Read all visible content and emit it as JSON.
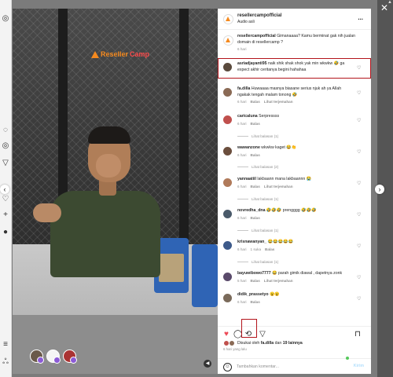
{
  "panel": {
    "username": "resellercampofficial",
    "audio": "Audio asli",
    "more": "..."
  },
  "video": {
    "logo_text_a": "Reseller",
    "logo_text_b": "Camp"
  },
  "comments": [
    {
      "user": "resellercampofficial",
      "text": "Gimanaaaa? Kamu berminat gak nih jualan domain di resellercamp ?",
      "time": "6 hari",
      "reply": "",
      "translate": "",
      "color": "#ffffff"
    },
    {
      "user": "asriadjayanti95",
      "text": "naik shik shak shok yak min wkwkw 🤣 ga expect akhir ceritanya begini hahahaa",
      "time": "",
      "reply": "",
      "translate": "",
      "color": "#5a4a3d"
    },
    {
      "user": "fa.dilla",
      "text": "Huwaaaa masnya biasane serius njuk ah ya Allah ngakak tengah malam tonong 🤣",
      "time": "6 hari",
      "reply": "Balas",
      "translate": "Lihat terjemahan",
      "color": "#8a6a55"
    },
    {
      "user": "caricaluna",
      "text": "Serpressss",
      "time": "6 hari",
      "reply": "Balas",
      "translate": "",
      "color": "#c0504d"
    },
    {
      "user": "wawanzone",
      "text": "wkwkw kaget 😂👏",
      "time": "6 hari",
      "reply": "Balas",
      "translate": "",
      "color": "#6b4e3d"
    },
    {
      "user": "yannaatiil",
      "text": "lakbaann mana lakbaannn 😭",
      "time": "6 hari",
      "reply": "Balas",
      "translate": "Lihat terjemahan",
      "color": "#b07a5a"
    },
    {
      "user": "novredha_dna",
      "text": "🤣🤣🤣 prengggg 🤣🤣🤣",
      "time": "6 hari",
      "reply": "Balas",
      "translate": "",
      "color": "#4a5a6a"
    },
    {
      "user": "krisnawanyan_",
      "text": "😂😂😂😂😂",
      "time": "6 hari",
      "reply": "Balas",
      "likes": "1 suka",
      "translate": "",
      "color": "#3d5a8a"
    },
    {
      "user": "bayuwibowo7777",
      "text": "😂 parah gimik diawal , dapetnya zonk",
      "time": "5 hari",
      "reply": "Balas",
      "translate": "Lihat terjemahan",
      "color": "#5a4a6b"
    },
    {
      "user": "didik_prassetyo",
      "text": "😮😮",
      "time": "6 hari",
      "reply": "Balas",
      "translate": "",
      "color": "#7a6a5a"
    }
  ],
  "view_replies": [
    "Lihat balasan (1)",
    "Lihat balasan (2)",
    "Lihat balasan (1)",
    "Lihat balasan (1)",
    "Lihat balasan (1)"
  ],
  "likes": {
    "text_prefix": "Disukai oleh",
    "user": "fa.dilla",
    "text_mid": "dan",
    "count": "19 lainnya",
    "time": "6 hari yang lalu"
  },
  "input": {
    "placeholder": "Tambahkan komentar...",
    "post": "Kirim"
  },
  "colors": {
    "highlight": "#b3141b",
    "like_red": "#ed4956",
    "brand_orange": "#f58a1f"
  }
}
